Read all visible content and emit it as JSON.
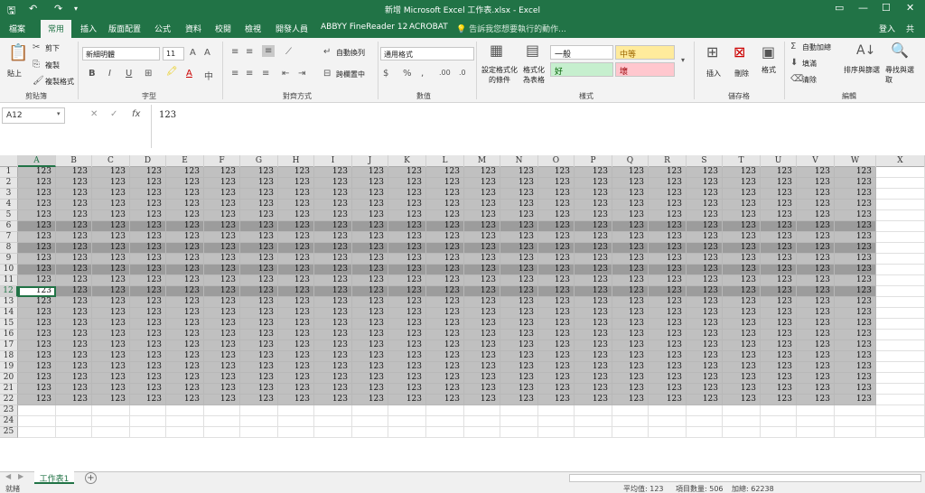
{
  "window": {
    "title": "新增 Microsoft Excel 工作表.xlsx - Excel",
    "quick_access": [
      "save-icon",
      "undo-icon",
      "redo-icon",
      "customize-icon"
    ],
    "controls": [
      "ribbon-options-icon",
      "minimize-icon",
      "maximize-icon",
      "close-icon"
    ]
  },
  "tabs": [
    {
      "label": "檔案"
    },
    {
      "label": "常用",
      "active": true
    },
    {
      "label": "插入"
    },
    {
      "label": "版面配置"
    },
    {
      "label": "公式"
    },
    {
      "label": "資料"
    },
    {
      "label": "校閱"
    },
    {
      "label": "檢視"
    },
    {
      "label": "開發人員"
    },
    {
      "label": "ABBYY FineReader 12"
    },
    {
      "label": "ACROBAT"
    }
  ],
  "tell_me": "告訴我您想要執行的動作...",
  "login": "登入",
  "share": "共",
  "ribbon": {
    "clipboard": {
      "paste": "貼上",
      "cut": "剪下",
      "copy": "複製",
      "format_painter": "複製格式",
      "label": "剪貼簿"
    },
    "font": {
      "name": "新細明體",
      "size": "11",
      "label": "字型"
    },
    "alignment": {
      "wrap": "自動換列",
      "merge": "跨欄置中",
      "label": "對齊方式"
    },
    "number": {
      "format": "通用格式",
      "label": "數值"
    },
    "styles": {
      "cond_format": "設定格式化的條件",
      "as_table": "格式化為表格",
      "normal": "一般",
      "neutral": "中等",
      "good": "好",
      "bad": "壞",
      "label": "樣式"
    },
    "cells": {
      "insert": "插入",
      "delete": "刪除",
      "format": "格式",
      "label": "儲存格"
    },
    "editing": {
      "autosum": "自動加總",
      "fill": "填滿",
      "clear": "清除",
      "sort": "排序與篩選",
      "find": "尋找與選取",
      "label": "編輯"
    }
  },
  "formula_bar": {
    "name_box": "A12",
    "fx": "fx",
    "value": "123"
  },
  "grid": {
    "columns": [
      "A",
      "B",
      "C",
      "D",
      "E",
      "F",
      "G",
      "H",
      "I",
      "J",
      "K",
      "L",
      "M",
      "N",
      "O",
      "P",
      "Q",
      "R",
      "S",
      "T",
      "U",
      "V",
      "W",
      "X"
    ],
    "rows": [
      "1",
      "2",
      "3",
      "4",
      "5",
      "6",
      "7",
      "8",
      "9",
      "10",
      "11",
      "12",
      "13",
      "14",
      "15",
      "16",
      "17",
      "18",
      "19",
      "20",
      "21",
      "22",
      "23",
      "24",
      "25"
    ],
    "cell_value": "123",
    "filled_rows": 22,
    "filled_cols": 23,
    "dark_rows": [
      6,
      8,
      10,
      12
    ],
    "selected_cell": "A12",
    "fill_light": "#c0c0c0",
    "fill_dark": "#9c9c9c",
    "accent": "#217346"
  },
  "sheet_tab": "工作表1",
  "status": {
    "left": "就緒",
    "average": "平均值: 123",
    "count": "項目數量: 506",
    "sum": "加總: 62238"
  }
}
